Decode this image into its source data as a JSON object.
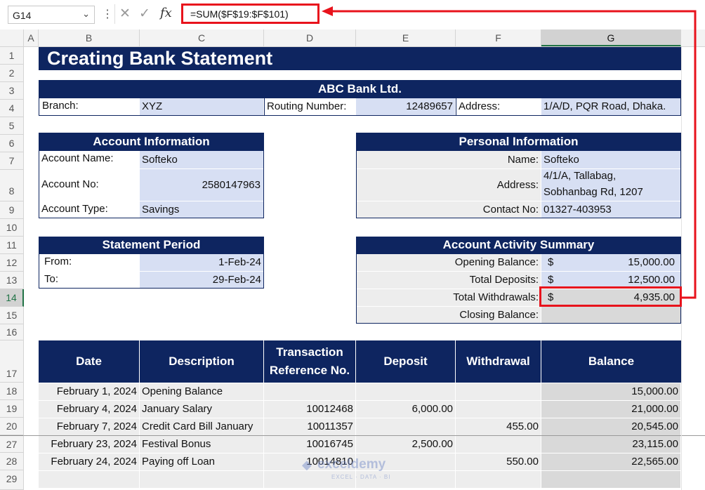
{
  "namebox": {
    "value": "G14"
  },
  "formula_bar": {
    "formula": "=SUM($F$19:$F$101)",
    "fx_label": "fx"
  },
  "columns": [
    "A",
    "B",
    "C",
    "D",
    "E",
    "F",
    "G"
  ],
  "rows": [
    "1",
    "2",
    "3",
    "4",
    "5",
    "6",
    "7",
    "8",
    "9",
    "10",
    "11",
    "12",
    "13",
    "14",
    "15",
    "16",
    "17",
    "18",
    "19",
    "20",
    "27",
    "28",
    "29"
  ],
  "title": "Creating Bank Statement",
  "bank": {
    "name": "ABC Bank Ltd.",
    "branch_label": "Branch:",
    "branch": "XYZ",
    "routing_label": "Routing Number:",
    "routing": "12489657",
    "address_label": "Address:",
    "address": "1/A/D, PQR Road, Dhaka."
  },
  "account": {
    "header": "Account Information",
    "name_label": "Account Name:",
    "name": "Softeko",
    "no_label": "Account No:",
    "no": "2580147963",
    "type_label": "Account Type:",
    "type": "Savings"
  },
  "personal": {
    "header": "Personal Information",
    "name_label": "Name:",
    "name": "Softeko",
    "address_label": "Address:",
    "address_line1": "4/1/A, Tallabag,",
    "address_line2": "Sobhanbag Rd, 1207",
    "contact_label": "Contact No:",
    "contact": "01327-403953"
  },
  "period": {
    "header": "Statement Period",
    "from_label": "From:",
    "from": "1-Feb-24",
    "to_label": "To:",
    "to": "29-Feb-24"
  },
  "summary": {
    "header": "Account Activity Summary",
    "currency": "$",
    "opening_label": "Opening Balance:",
    "opening": "15,000.00",
    "deposits_label": "Total Deposits:",
    "deposits": "12,500.00",
    "withdrawals_label": "Total Withdrawals:",
    "withdrawals": "4,935.00",
    "closing_label": "Closing Balance:"
  },
  "table": {
    "headers": {
      "date": "Date",
      "description": "Description",
      "ref1": "Transaction",
      "ref2": "Reference No.",
      "deposit": "Deposit",
      "withdrawal": "Withdrawal",
      "balance": "Balance"
    },
    "rows": [
      {
        "date": "February 1, 2024",
        "description": "Opening Balance",
        "ref": "",
        "deposit": "",
        "withdrawal": "",
        "balance": "15,000.00"
      },
      {
        "date": "February 4, 2024",
        "description": "January Salary",
        "ref": "10012468",
        "deposit": "6,000.00",
        "withdrawal": "",
        "balance": "21,000.00"
      },
      {
        "date": "February 7, 2024",
        "description": "Credit Card Bill January",
        "ref": "10011357",
        "deposit": "",
        "withdrawal": "455.00",
        "balance": "20,545.00"
      },
      {
        "date": "February 23, 2024",
        "description": "Festival Bonus",
        "ref": "10016745",
        "deposit": "2,500.00",
        "withdrawal": "",
        "balance": "23,115.00"
      },
      {
        "date": "February 24, 2024",
        "description": "Paying off Loan",
        "ref": "10014810",
        "deposit": "",
        "withdrawal": "550.00",
        "balance": "22,565.00"
      }
    ]
  },
  "watermark": {
    "brand": "exceldemy",
    "tagline": "EXCEL · DATA · BI"
  },
  "colors": {
    "navy": "#0e2560",
    "light_blue": "#d7dff3",
    "highlight_red": "#e8131c",
    "excel_green": "#217346"
  }
}
